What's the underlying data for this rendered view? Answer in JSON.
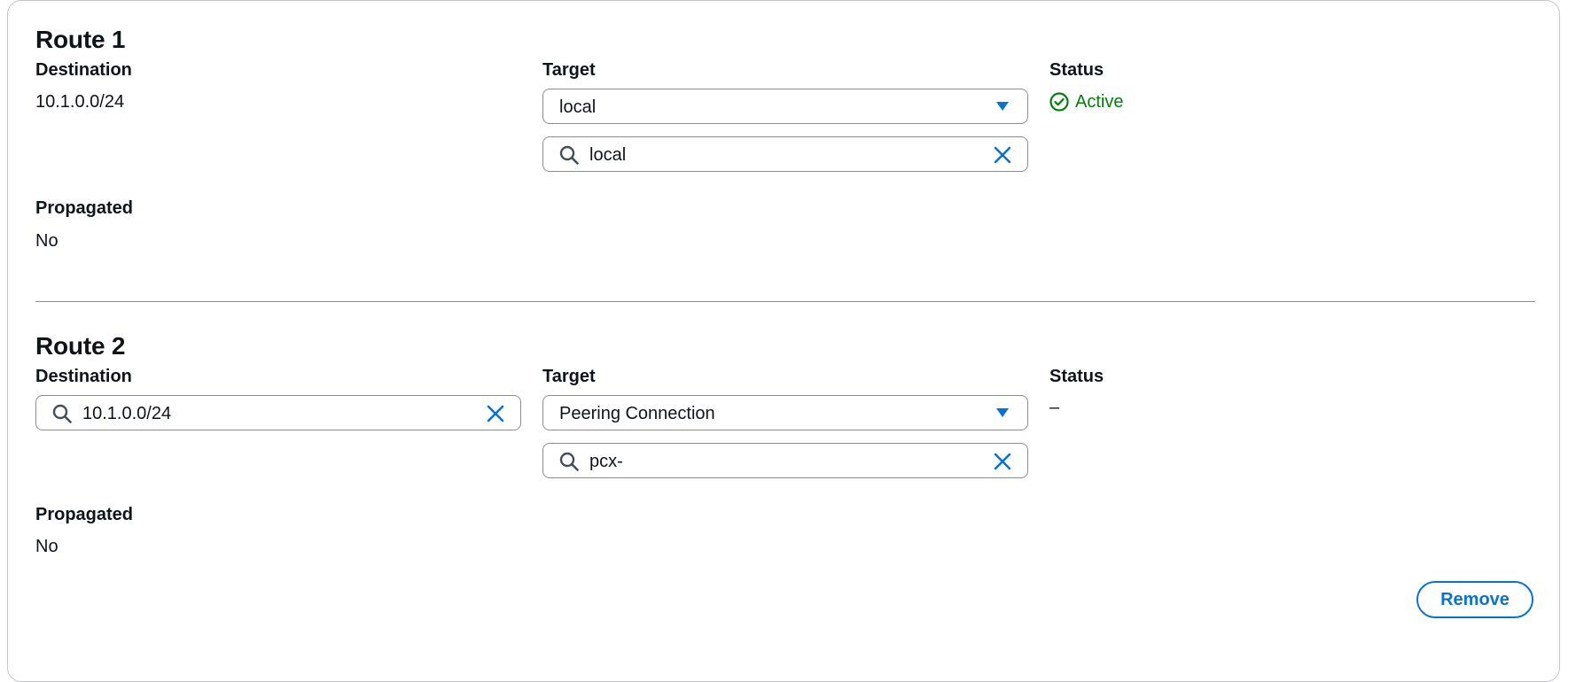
{
  "routes": [
    {
      "title": "Route 1",
      "destination_label": "Destination",
      "destination_value": "10.1.0.0/24",
      "target_label": "Target",
      "target_select": "local",
      "target_search": "local",
      "status_label": "Status",
      "status_value": "Active",
      "propagated_label": "Propagated",
      "propagated_value": "No"
    },
    {
      "title": "Route 2",
      "destination_label": "Destination",
      "destination_search": "10.1.0.0/24",
      "target_label": "Target",
      "target_select": "Peering Connection",
      "target_search": "pcx-",
      "status_label": "Status",
      "status_value": "–",
      "propagated_label": "Propagated",
      "propagated_value": "No",
      "remove_label": "Remove"
    }
  ],
  "colors": {
    "accent": "#0972d3",
    "success": "#037f0c",
    "border": "#8c8c94"
  },
  "icons": {
    "caret": "caret-down-icon",
    "search": "search-icon",
    "clear": "close-icon",
    "status": "check-circle-icon"
  }
}
